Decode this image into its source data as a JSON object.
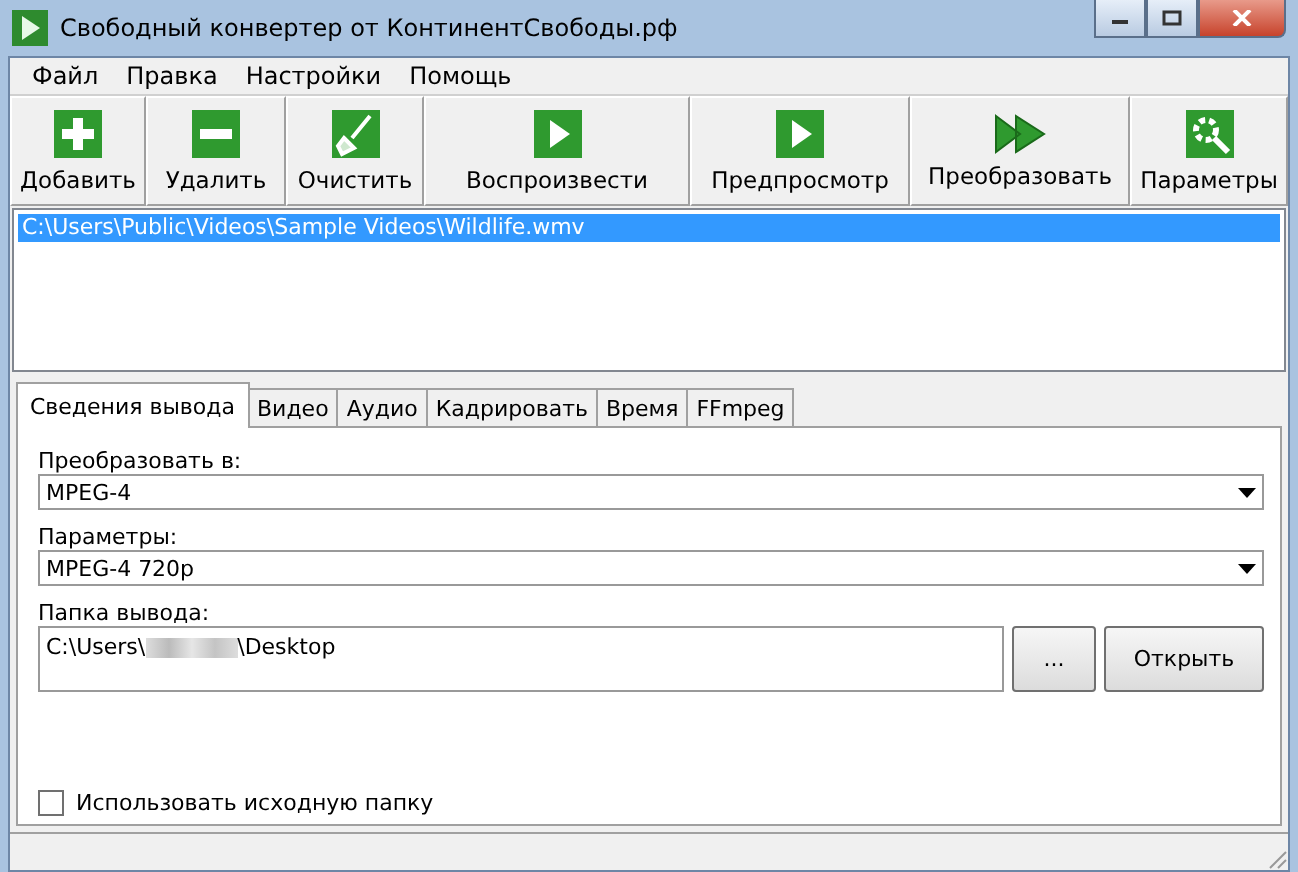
{
  "window": {
    "title": "Свободный конвертер от КонтинентСвободы.рф"
  },
  "menu": [
    "Файл",
    "Правка",
    "Настройки",
    "Помощь"
  ],
  "toolbar": [
    {
      "label": "Добавить",
      "kind": "add"
    },
    {
      "label": "Удалить",
      "kind": "remove"
    },
    {
      "label": "Очистить",
      "kind": "clear"
    },
    {
      "label": "Воспроизвести",
      "kind": "play"
    },
    {
      "label": "Предпросмотр",
      "kind": "preview"
    },
    {
      "label": "Преобразовать",
      "kind": "convert"
    },
    {
      "label": "Параметры",
      "kind": "settings"
    }
  ],
  "files": [
    {
      "path": "C:\\Users\\Public\\Videos\\Sample Videos\\Wildlife.wmv",
      "selected": true
    }
  ],
  "tabs": [
    {
      "label": "Сведения вывода",
      "selected": true
    },
    {
      "label": "Видео",
      "selected": false
    },
    {
      "label": "Аудио",
      "selected": false
    },
    {
      "label": "Кадрировать",
      "selected": false
    },
    {
      "label": "Время",
      "selected": false
    },
    {
      "label": "FFmpeg",
      "selected": false
    }
  ],
  "convert_to": {
    "label": "Преобразовать в:",
    "value": "MPEG-4"
  },
  "parameters": {
    "label": "Параметры:",
    "value": "MPEG-4 720p"
  },
  "output_folder": {
    "label": "Папка вывода:",
    "value_start": "C:\\Users\\",
    "value_end": "\\Desktop",
    "browse": "...",
    "open": "Открыть"
  },
  "use_source_folder": {
    "label": "Использовать исходную папку",
    "checked": false
  }
}
